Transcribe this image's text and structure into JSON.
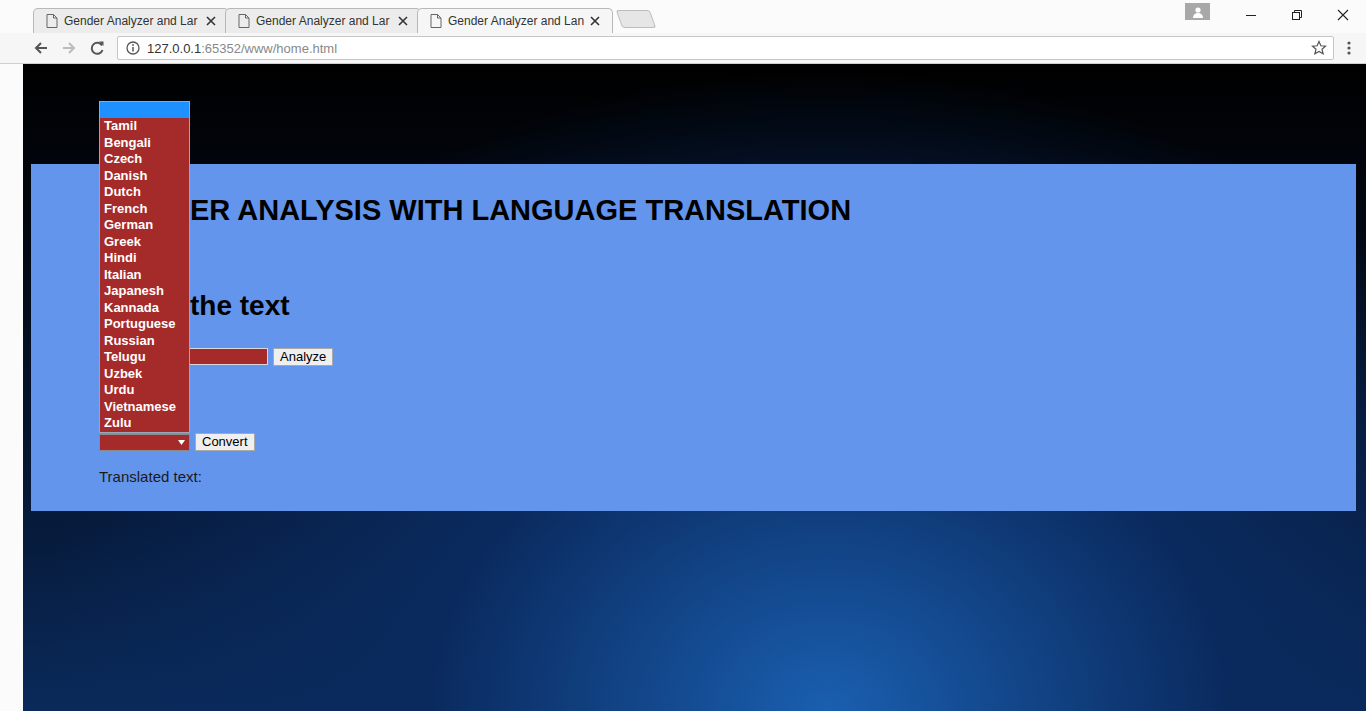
{
  "browser": {
    "tabs": [
      {
        "label": "Gender Analyzer and Lar",
        "selected": false
      },
      {
        "label": "Gender Analyzer and Lar",
        "selected": false
      },
      {
        "label": "Gender Analyzer and Lan",
        "selected": true
      }
    ],
    "url_host": "127.0.0.1",
    "url_rest": ":65352/www/home.html"
  },
  "page": {
    "title": "ER ANALYSIS WITH LANGUAGE TRANSLATION",
    "subtitle": "the text",
    "analyze_button": "Analyze",
    "convert_button": "Convert",
    "translated_label": "Translated text:",
    "language_options": [
      {
        "label": "",
        "selected": true
      },
      {
        "label": "Tamil",
        "selected": false
      },
      {
        "label": "Bengali",
        "selected": false
      },
      {
        "label": "Czech",
        "selected": false
      },
      {
        "label": "Danish",
        "selected": false
      },
      {
        "label": "Dutch",
        "selected": false
      },
      {
        "label": "French",
        "selected": false
      },
      {
        "label": "German",
        "selected": false
      },
      {
        "label": "Greek",
        "selected": false
      },
      {
        "label": "Hindi",
        "selected": false
      },
      {
        "label": "Italian",
        "selected": false
      },
      {
        "label": "Japanesh",
        "selected": false
      },
      {
        "label": "Kannada",
        "selected": false
      },
      {
        "label": "Portuguese",
        "selected": false
      },
      {
        "label": "Russian",
        "selected": false
      },
      {
        "label": "Telugu",
        "selected": false
      },
      {
        "label": "Uzbek",
        "selected": false
      },
      {
        "label": "Urdu",
        "selected": false
      },
      {
        "label": "Vietnamese",
        "selected": false
      },
      {
        "label": "Zulu",
        "selected": false
      }
    ]
  }
}
